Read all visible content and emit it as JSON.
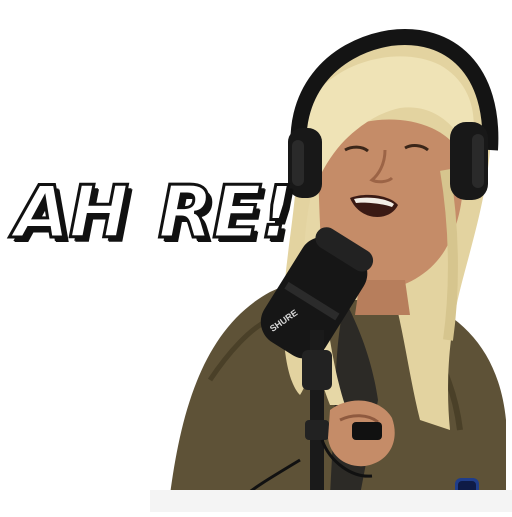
{
  "caption": {
    "left": "AH",
    "right": "RE!"
  },
  "mic": {
    "brand": "SHURE"
  },
  "colors": {
    "background": "#ffffff",
    "wig": "#e6d7a6",
    "shirt": "#5f5238",
    "skin": "#c98f6c",
    "headphones": "#1a1a1a",
    "mic": "#151515",
    "caption_fill": "#ffffff",
    "caption_outline": "#111111"
  }
}
